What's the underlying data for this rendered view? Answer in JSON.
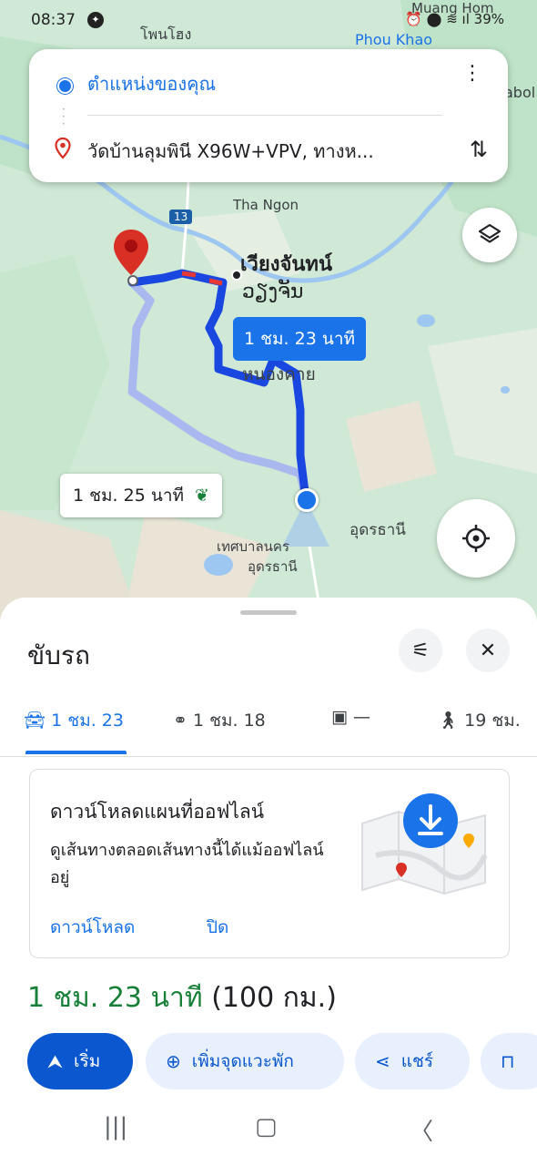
{
  "status_bar": {
    "time": "08:37",
    "message_icon": "messenger-icon",
    "battery": "39%"
  },
  "map": {
    "labels": {
      "phon_hong": "โพนโฮง",
      "muang_hom": "Muang Hom",
      "phou_khao": "Phou Khao",
      "abol": "abol",
      "tha_ngon": "Tha Ngon",
      "road_13": "13",
      "vientiane_th": "เวียงจันทน์",
      "vientiane_lao": "ວຽງຈັນ",
      "nong_khai": "หนองคาย",
      "udon_thani": "อุดรธานี",
      "udon_city_1": "เทศบาลนคร",
      "udon_city_2": "อุดรธานี"
    },
    "route_main_label": "1 ชม. 23 นาที",
    "route_alt_label": "1 ชม. 25 นาที"
  },
  "search": {
    "origin": "ตำแหน่งของคุณ",
    "destination": "วัดบ้านลุมพินี X96W+VPV, ทางห..."
  },
  "sheet": {
    "title": "ขับรถ",
    "modes": [
      {
        "label": "1 ชม. 23",
        "icon": "car-icon"
      },
      {
        "label": "1 ชม. 18",
        "icon": "motorcycle-icon"
      },
      {
        "label": "—",
        "icon": "transit-icon"
      },
      {
        "label": "19 ชม.",
        "icon": "walk-icon"
      }
    ],
    "offline": {
      "heading": "ดาวน์โหลดแผนที่ออฟไลน์",
      "description": "ดูเส้นทางตลอดเส้นทางนี้ได้แม้ออฟไลน์อยู่",
      "download": "ดาวน์โหลด",
      "close": "ปิด"
    },
    "summary_time": "1 ชม. 23 นาที",
    "summary_distance": "(100 กม.)",
    "actions": {
      "start": "เริ่ม",
      "add_stop": "เพิ่มจุดแวะพัก",
      "share": "แชร์"
    }
  },
  "colors": {
    "accent": "#1a73e8",
    "route": "#1a47e0",
    "green": "#188038",
    "pin": "#d93025"
  }
}
